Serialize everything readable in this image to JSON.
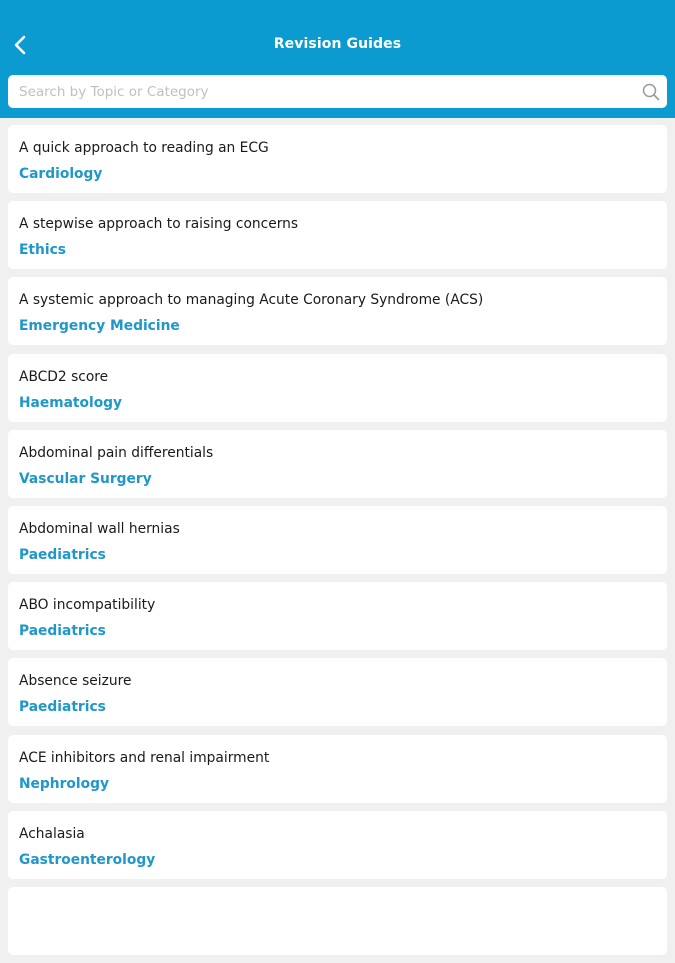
{
  "header": {
    "title": "Revision Guides",
    "back_icon": "chevron-left-icon",
    "background_color": "#0c9bd0"
  },
  "search": {
    "placeholder": "Search by Topic or Category",
    "value": "",
    "icon": "search-icon"
  },
  "colors": {
    "accent": "#1f97c9",
    "background": "#f0f0f0"
  },
  "guides": [
    {
      "title": "A quick approach to reading an ECG",
      "category": "Cardiology"
    },
    {
      "title": "A stepwise approach to raising concerns",
      "category": "Ethics"
    },
    {
      "title": "A systemic approach to managing Acute Coronary Syndrome (ACS)",
      "category": "Emergency Medicine"
    },
    {
      "title": "ABCD2 score",
      "category": "Haematology"
    },
    {
      "title": "Abdominal pain differentials",
      "category": "Vascular Surgery"
    },
    {
      "title": "Abdominal wall hernias",
      "category": "Paediatrics"
    },
    {
      "title": "ABO incompatibility",
      "category": "Paediatrics"
    },
    {
      "title": "Absence seizure",
      "category": "Paediatrics"
    },
    {
      "title": "ACE inhibitors and renal impairment",
      "category": "Nephrology"
    },
    {
      "title": "Achalasia",
      "category": "Gastroenterology"
    },
    {
      "title": "",
      "category": ""
    }
  ]
}
